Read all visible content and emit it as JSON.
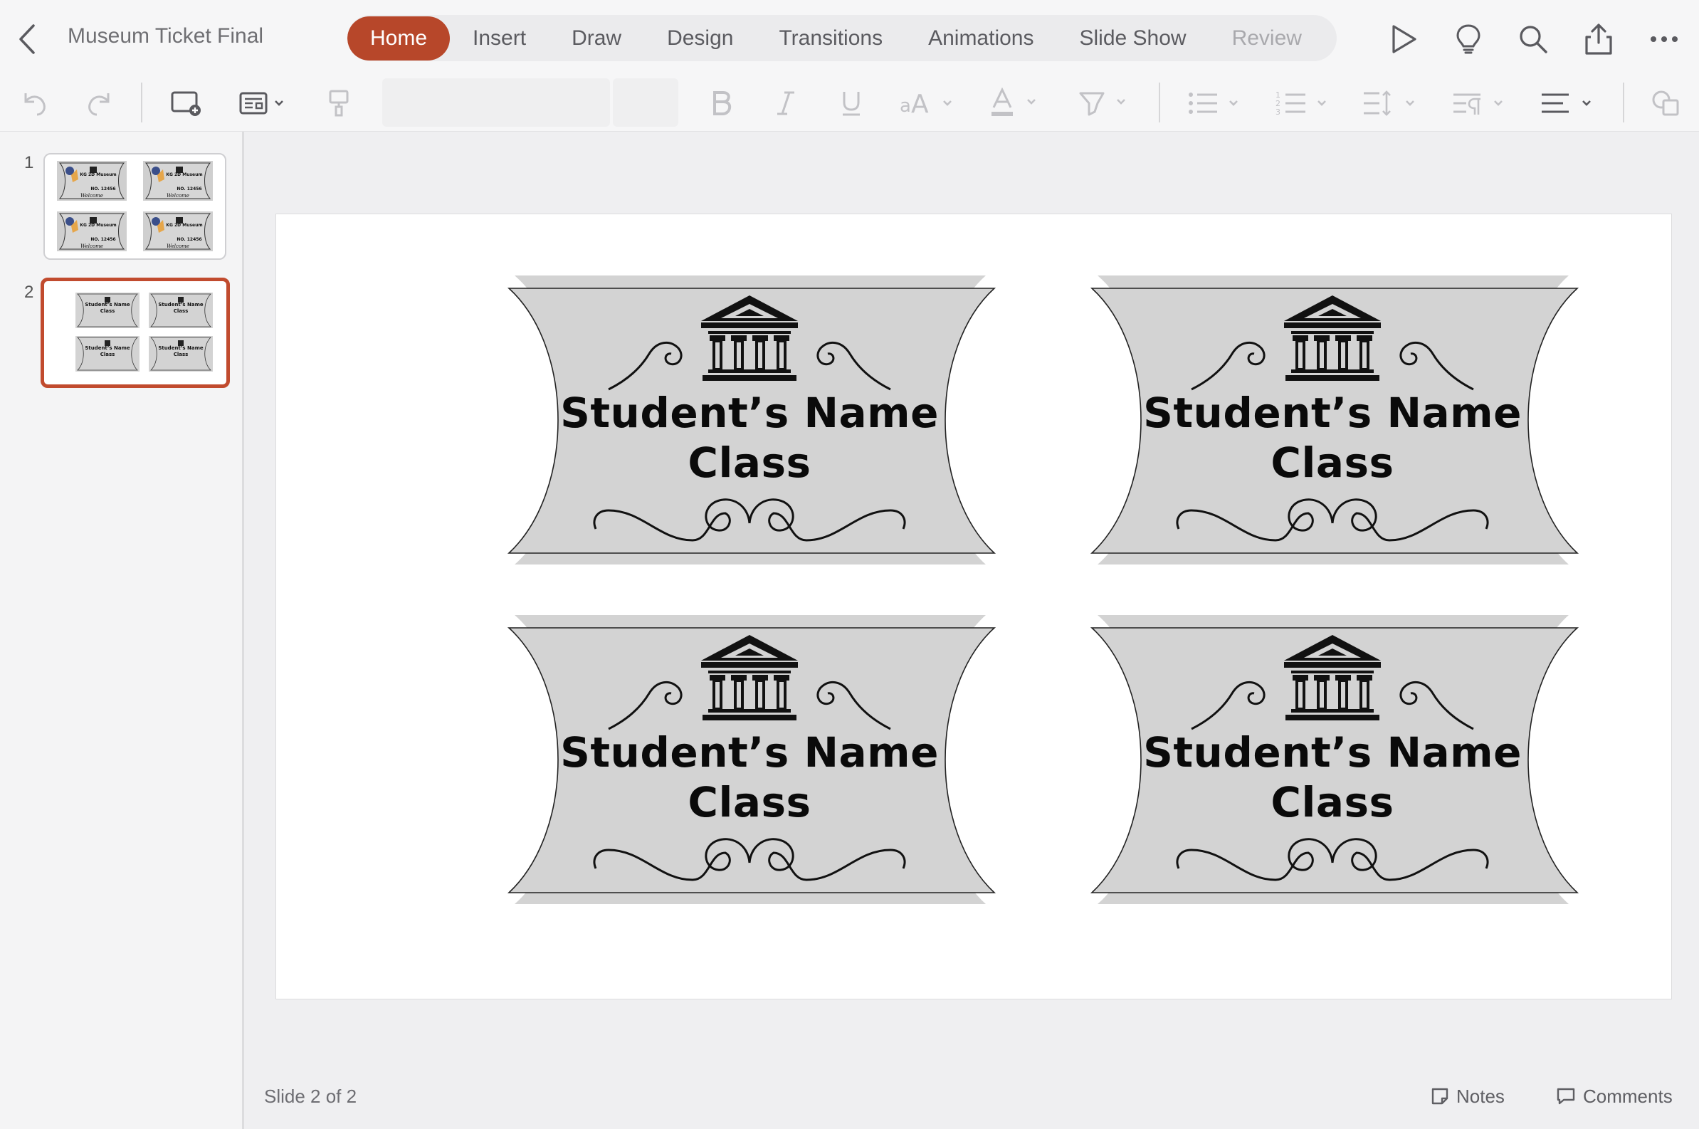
{
  "app": {
    "title": "Museum Ticket Final"
  },
  "tabs": [
    {
      "label": "Home",
      "active": true
    },
    {
      "label": "Insert"
    },
    {
      "label": "Draw"
    },
    {
      "label": "Design"
    },
    {
      "label": "Transitions"
    },
    {
      "label": "Animations"
    },
    {
      "label": "Slide Show"
    },
    {
      "label": "Review"
    }
  ],
  "top_icons": [
    "play-icon",
    "lightbulb-icon",
    "search-icon",
    "share-icon",
    "more-icon"
  ],
  "ribbon": {
    "font_name": "",
    "font_size": "",
    "icons": [
      "undo-icon",
      "redo-icon",
      "new-slide-icon",
      "layout-icon",
      "format-painter-icon",
      "bold-icon",
      "italic-icon",
      "underline-icon",
      "font-size-icon",
      "font-color-icon",
      "highlight-icon",
      "bullets-icon",
      "numbering-icon",
      "line-spacing-icon",
      "paragraph-icon",
      "align-icon",
      "shapes-icon"
    ]
  },
  "thumbnails": [
    {
      "number": "1",
      "ticket_text": [
        "KG 2D Museum",
        "NO. 12456",
        "Welcome"
      ]
    },
    {
      "number": "2",
      "selected": true,
      "ticket_text": [
        "Student’s Name",
        "Class"
      ]
    }
  ],
  "slide": {
    "tickets": [
      {
        "line1": "Student’s Name",
        "line2": "Class"
      },
      {
        "line1": "Student’s Name",
        "line2": "Class"
      },
      {
        "line1": "Student’s Name",
        "line2": "Class"
      },
      {
        "line1": "Student’s Name",
        "line2": "Class"
      }
    ]
  },
  "status": {
    "slide_counter": "Slide 2 of 2",
    "notes_label": "Notes",
    "comments_label": "Comments"
  },
  "colors": {
    "accent": "#b7472a",
    "ticket_gray": "#d3d3d3"
  }
}
